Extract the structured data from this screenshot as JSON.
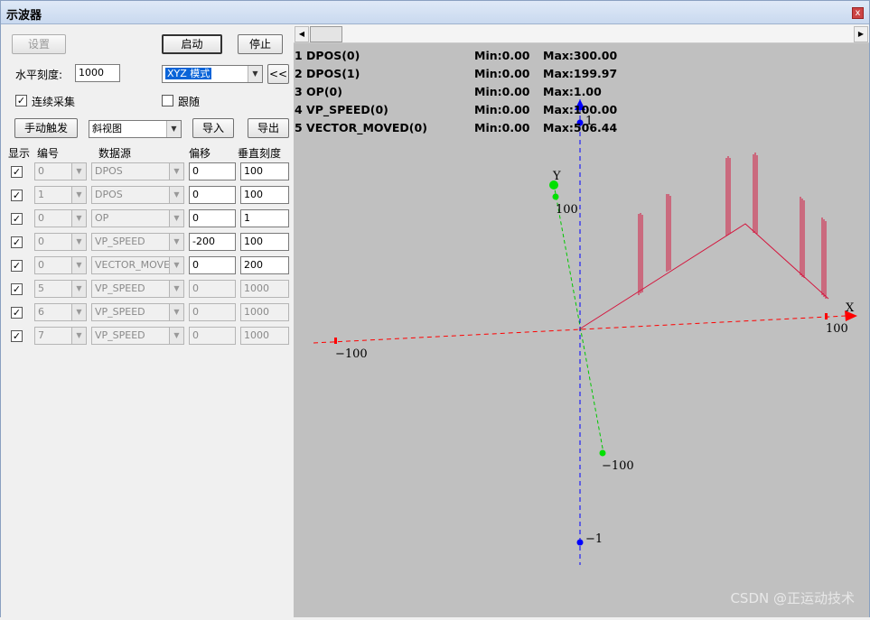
{
  "window": {
    "title": "示波器",
    "close_label": "x"
  },
  "toolbar": {
    "settings_label": "设置",
    "start_label": "启动",
    "stop_label": "停止",
    "horizontal_scale_label": "水平刻度:",
    "horizontal_scale_value": "1000",
    "mode_value": "XYZ 模式",
    "collapse_label": "<<",
    "continuous_label": "连续采集",
    "follow_label": "跟随",
    "manual_trigger_label": "手动触发",
    "view_value": "斜视图",
    "import_label": "导入",
    "export_label": "导出"
  },
  "channel_table": {
    "headers": {
      "show": "显示",
      "index": "编号",
      "source": "数据源",
      "offset": "偏移",
      "vscale": "垂直刻度"
    },
    "rows": [
      {
        "checked": "✓",
        "index": "0",
        "source": "DPOS",
        "offset": "0",
        "vscale": "100",
        "enabled": true
      },
      {
        "checked": "✓",
        "index": "1",
        "source": "DPOS",
        "offset": "0",
        "vscale": "100",
        "enabled": true
      },
      {
        "checked": "✓",
        "index": "0",
        "source": "OP",
        "offset": "0",
        "vscale": "1",
        "enabled": true
      },
      {
        "checked": "✓",
        "index": "0",
        "source": "VP_SPEED",
        "offset": "-200",
        "vscale": "100",
        "enabled": true
      },
      {
        "checked": "✓",
        "index": "0",
        "source": "VECTOR_MOVED",
        "offset": "0",
        "vscale": "200",
        "enabled": true
      },
      {
        "checked": "✓",
        "index": "5",
        "source": "VP_SPEED",
        "offset": "0",
        "vscale": "1000",
        "enabled": false
      },
      {
        "checked": "✓",
        "index": "6",
        "source": "VP_SPEED",
        "offset": "0",
        "vscale": "1000",
        "enabled": false
      },
      {
        "checked": "✓",
        "index": "7",
        "source": "VP_SPEED",
        "offset": "0",
        "vscale": "1000",
        "enabled": false
      }
    ]
  },
  "legend": [
    {
      "name": "1 DPOS(0)",
      "min": "Min:0.00",
      "max": "Max:300.00"
    },
    {
      "name": "2 DPOS(1)",
      "min": "Min:0.00",
      "max": "Max:199.97"
    },
    {
      "name": "3 OP(0)",
      "min": "Min:0.00",
      "max": "Max:1.00"
    },
    {
      "name": "4 VP_SPEED(0)",
      "min": "Min:0.00",
      "max": "Max:100.00"
    },
    {
      "name": "5 VECTOR_MOVED(0)",
      "min": "Min:0.00",
      "max": "Max:506.44"
    }
  ],
  "plot": {
    "background": "#c0c0c0",
    "trace_color": "#d4143c",
    "x_axis_color": "#ff0000",
    "y_axis_color": "#00c800",
    "z_axis_color": "#0000ff",
    "x_label": "X",
    "y_label": "Y",
    "x_pos_tick": "100",
    "x_neg_tick": "−100",
    "y_pos_tick": "100",
    "y_neg_tick": "−100",
    "z_pos_tick": "1",
    "z_neg_tick": "−1"
  },
  "watermark": "CSDN @正运动技术"
}
